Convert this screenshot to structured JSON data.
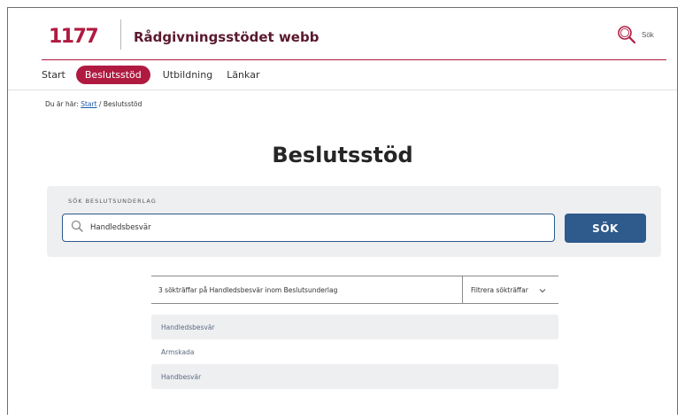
{
  "header": {
    "logo_text": "1177",
    "site_title": "Rådgivningsstödet webb",
    "search_label": "Sök",
    "brand_color": "#b01a41"
  },
  "nav": {
    "items": [
      {
        "label": "Start",
        "active": false
      },
      {
        "label": "Beslutsstöd",
        "active": true
      },
      {
        "label": "Utbildning",
        "active": false
      },
      {
        "label": "Länkar",
        "active": false
      }
    ]
  },
  "breadcrumb": {
    "prefix": "Du är här:",
    "link": "Start",
    "separator": "/",
    "current": "Beslutsstöd"
  },
  "page": {
    "title": "Beslutsstöd"
  },
  "search": {
    "section_label": "SÖK BESLUTSUNDERLAG",
    "value": "Handledsbesvär",
    "button_label": "SÖK",
    "button_color": "#2e5a8c"
  },
  "results": {
    "summary": "3 sökträffar på Handledsbesvär inom Beslutsunderlag",
    "filter_label": "Filtrera sökträffar",
    "items": [
      {
        "label": "Handledsbesvär"
      },
      {
        "label": "Armskada"
      },
      {
        "label": "Handbesvär"
      }
    ]
  }
}
